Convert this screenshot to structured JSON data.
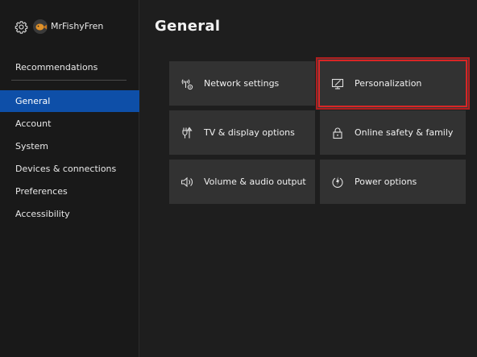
{
  "profile": {
    "gamertag": "MrFishyFren"
  },
  "sidebar": {
    "recommendations": "Recommendations",
    "items": [
      {
        "label": "General",
        "selected": true
      },
      {
        "label": "Account"
      },
      {
        "label": "System"
      },
      {
        "label": "Devices & connections"
      },
      {
        "label": "Preferences"
      },
      {
        "label": "Accessibility"
      }
    ]
  },
  "main": {
    "title": "General",
    "tiles": [
      {
        "label": "Network settings",
        "icon": "network-icon"
      },
      {
        "label": "Personalization",
        "icon": "monitor-edit-icon",
        "focused": true
      },
      {
        "label": "TV & display options",
        "icon": "tv-display-icon"
      },
      {
        "label": "Online safety & family",
        "icon": "lock-icon"
      },
      {
        "label": "Volume & audio output",
        "icon": "speaker-icon"
      },
      {
        "label": "Power options",
        "icon": "power-icon"
      }
    ]
  },
  "colors": {
    "background": "#1e1e1e",
    "sidebar": "#191919",
    "selected": "#0e4fa8",
    "tile": "#323232",
    "focus_outline": "#d92626"
  }
}
